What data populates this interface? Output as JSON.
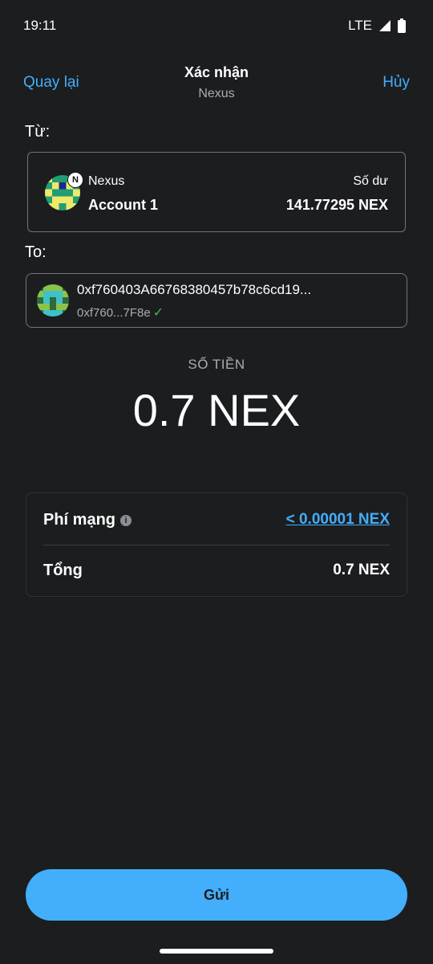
{
  "status_bar": {
    "time": "19:11",
    "network": "LTE",
    "signal_icon": "signal-icon",
    "battery_icon": "battery-icon"
  },
  "nav": {
    "back_label": "Quay lại",
    "title": "Xác nhận",
    "subtitle": "Nexus",
    "cancel_label": "Hủy"
  },
  "from": {
    "section_label": "Từ:",
    "network_badge": "N",
    "network_name": "Nexus",
    "account_name": "Account 1",
    "balance_label": "Số dư",
    "balance_value": "141.77295 NEX"
  },
  "to": {
    "section_label": "To:",
    "address": "0xf760403A66768380457b78c6cd19...",
    "short_address": "0xf760...7F8e",
    "verified_icon": "check-icon"
  },
  "amount": {
    "label": "SỐ TIỀN",
    "value": "0.7 NEX"
  },
  "fees": {
    "network_fee_label": "Phí mạng",
    "info_icon": "info-icon",
    "network_fee_value": "< 0.00001 NEX",
    "total_label": "Tổng",
    "total_value": "0.7 NEX"
  },
  "actions": {
    "send_label": "Gửi"
  },
  "colors": {
    "background": "#1c1d1f",
    "accent": "#43aefc",
    "success": "#3fb950",
    "muted_text": "#a9adb2",
    "border": "#70757c"
  }
}
